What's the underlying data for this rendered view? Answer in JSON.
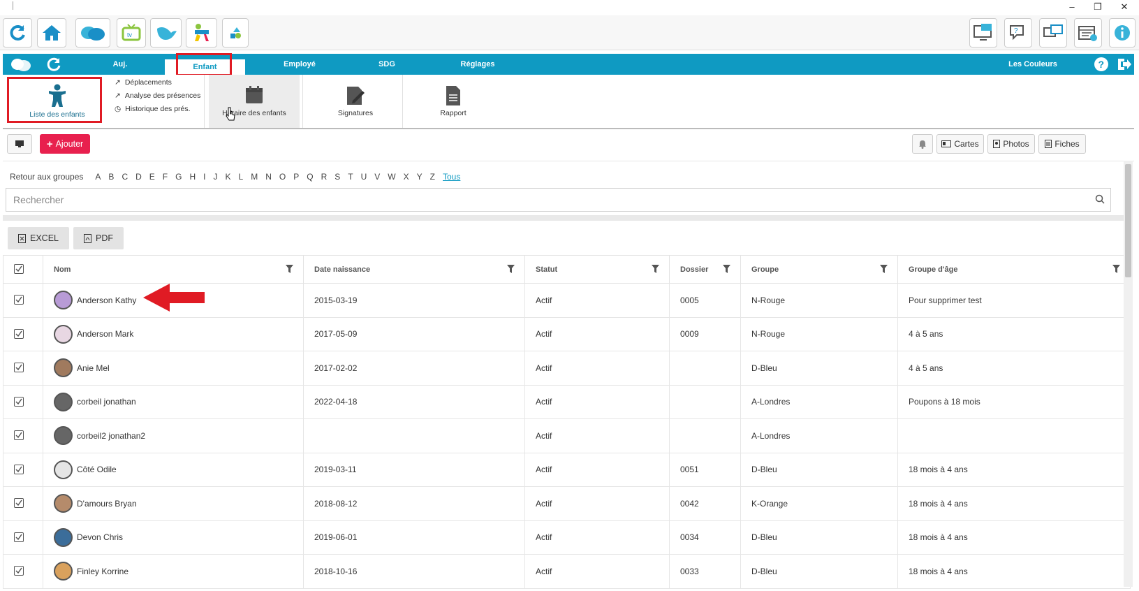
{
  "window": {
    "controls": [
      "–",
      "❐",
      "✕"
    ]
  },
  "toolbar": {
    "left_icons": [
      "refresh-icon",
      "home-icon",
      "cloud-logo-icon",
      "tv-icon",
      "bird-icon",
      "kids-icon",
      "shapes-icon"
    ],
    "right_icons": [
      "monitor-mail-icon",
      "help-chat-icon",
      "screens-icon",
      "calendar-clock-icon",
      "info-icon"
    ]
  },
  "nav": {
    "tabs": [
      "Auj.",
      "Enfant",
      "Employé",
      "SDG",
      "Réglages"
    ],
    "active_tab": "Enfant",
    "org_name": "Les Couleurs",
    "accent": "#0f9ac2"
  },
  "ribbon": {
    "children_list": "Liste des enfants",
    "deplacements": "Déplacements",
    "analyse": "Analyse des présences",
    "historique": "Historique des prés.",
    "horaire": "Horaire des enfants",
    "signatures": "Signatures",
    "rapport": "Rapport"
  },
  "actions": {
    "add_label": "Ajouter",
    "cards_label": "Cartes",
    "photos_label": "Photos",
    "fiches_label": "Fiches"
  },
  "alphabet": {
    "back_label": "Retour aux groupes",
    "letters": [
      "A",
      "B",
      "C",
      "D",
      "E",
      "F",
      "G",
      "H",
      "I",
      "J",
      "K",
      "L",
      "M",
      "N",
      "O",
      "P",
      "Q",
      "R",
      "S",
      "T",
      "U",
      "V",
      "W",
      "X",
      "Y",
      "Z"
    ],
    "all_label": "Tous"
  },
  "search": {
    "placeholder": "Rechercher"
  },
  "export": {
    "excel": "EXCEL",
    "pdf": "PDF"
  },
  "table": {
    "columns": [
      "Nom",
      "Date naissance",
      "Statut",
      "Dossier",
      "Groupe",
      "Groupe d'âge"
    ],
    "rows": [
      {
        "name": "Anderson Kathy",
        "dob": "2015-03-19",
        "status": "Actif",
        "dossier": "0005",
        "group": "N-Rouge",
        "age_group": "Pour supprimer test",
        "avatar_color": "#b89bd6"
      },
      {
        "name": "Anderson Mark",
        "dob": "2017-05-09",
        "status": "Actif",
        "dossier": "0009",
        "group": "N-Rouge",
        "age_group": "4 à 5 ans",
        "avatar_color": "#e8d7e3"
      },
      {
        "name": "Anie Mel",
        "dob": "2017-02-02",
        "status": "Actif",
        "dossier": "",
        "group": "D-Bleu",
        "age_group": "4 à 5 ans",
        "avatar_color": "#a07a5e"
      },
      {
        "name": "corbeil jonathan",
        "dob": "2022-04-18",
        "status": "Actif",
        "dossier": "",
        "group": "A-Londres",
        "age_group": "Poupons à 18 mois",
        "avatar_color": "#666666"
      },
      {
        "name": "corbeil2 jonathan2",
        "dob": "",
        "status": "Actif",
        "dossier": "",
        "group": "A-Londres",
        "age_group": "",
        "avatar_color": "#666666"
      },
      {
        "name": "Côté Odile",
        "dob": "2019-03-11",
        "status": "Actif",
        "dossier": "0051",
        "group": "D-Bleu",
        "age_group": "18 mois à 4 ans",
        "avatar_color": "#e5e5e5"
      },
      {
        "name": "D'amours Bryan",
        "dob": "2018-08-12",
        "status": "Actif",
        "dossier": "0042",
        "group": "K-Orange",
        "age_group": "18 mois à 4 ans",
        "avatar_color": "#b58b6b"
      },
      {
        "name": "Devon Chris",
        "dob": "2019-06-01",
        "status": "Actif",
        "dossier": "0034",
        "group": "D-Bleu",
        "age_group": "18 mois à 4 ans",
        "avatar_color": "#3b6d9a"
      },
      {
        "name": "Finley Korrine",
        "dob": "2018-10-16",
        "status": "Actif",
        "dossier": "0033",
        "group": "D-Bleu",
        "age_group": "18 mois à 4 ans",
        "avatar_color": "#d9a15d"
      }
    ]
  }
}
